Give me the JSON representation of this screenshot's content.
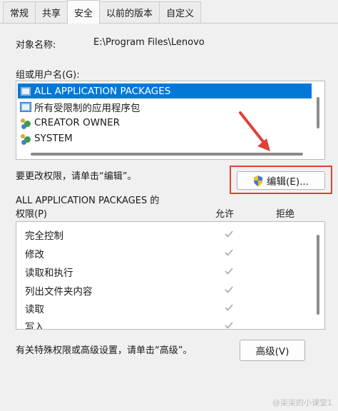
{
  "tabs": [
    "常规",
    "共享",
    "安全",
    "以前的版本",
    "自定义"
  ],
  "active_tab": "安全",
  "object_name_label": "对象名称:",
  "object_name_value": "E:\\Program Files\\Lenovo",
  "group_label": "组或用户名(G):",
  "users": [
    {
      "name": "ALL APPLICATION PACKAGES",
      "icon": "package-icon",
      "selected": true
    },
    {
      "name": "所有受限制的应用程序包",
      "icon": "package-icon",
      "selected": false
    },
    {
      "name": "CREATOR OWNER",
      "icon": "users-icon",
      "selected": false
    },
    {
      "name": "SYSTEM",
      "icon": "users-icon",
      "selected": false
    }
  ],
  "edit_hint": "要更改权限，请单击“编辑”。",
  "edit_button": "编辑(E)...",
  "perm_title": "ALL APPLICATION PACKAGES 的",
  "perm_label": "权限(P)",
  "allow_header": "允许",
  "deny_header": "拒绝",
  "permissions": [
    {
      "name": "完全控制",
      "allow": true,
      "deny": false
    },
    {
      "name": "修改",
      "allow": true,
      "deny": false
    },
    {
      "name": "读取和执行",
      "allow": true,
      "deny": false
    },
    {
      "name": "列出文件夹内容",
      "allow": true,
      "deny": false
    },
    {
      "name": "读取",
      "allow": true,
      "deny": false
    },
    {
      "name": "写入",
      "allow": true,
      "deny": false
    }
  ],
  "advanced_hint": "有关特殊权限或高级设置，请单击“高级”。",
  "advanced_button": "高级(V)",
  "watermark": "@柒柒的小课堂1",
  "colors": {
    "selection": "#0078d7",
    "annotation": "#e0403a",
    "check": "#a6a6a6"
  }
}
